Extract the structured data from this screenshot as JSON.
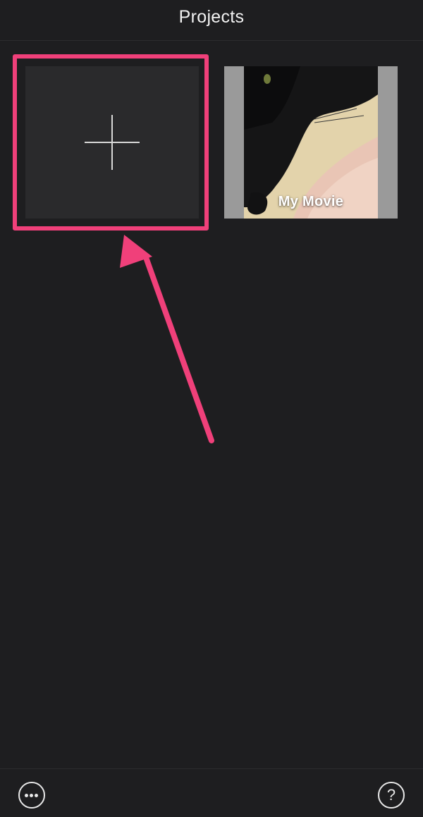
{
  "header": {
    "title": "Projects"
  },
  "projects": {
    "new_project_icon": "plus-icon",
    "items": [
      {
        "title": "My Movie"
      }
    ]
  },
  "annotation": {
    "color": "#f0407a"
  },
  "footer": {
    "more_icon": "ellipsis-icon",
    "help_label": "?"
  },
  "colors": {
    "background": "#1e1e20",
    "tile": "#2a2a2c",
    "text": "#ffffff"
  }
}
